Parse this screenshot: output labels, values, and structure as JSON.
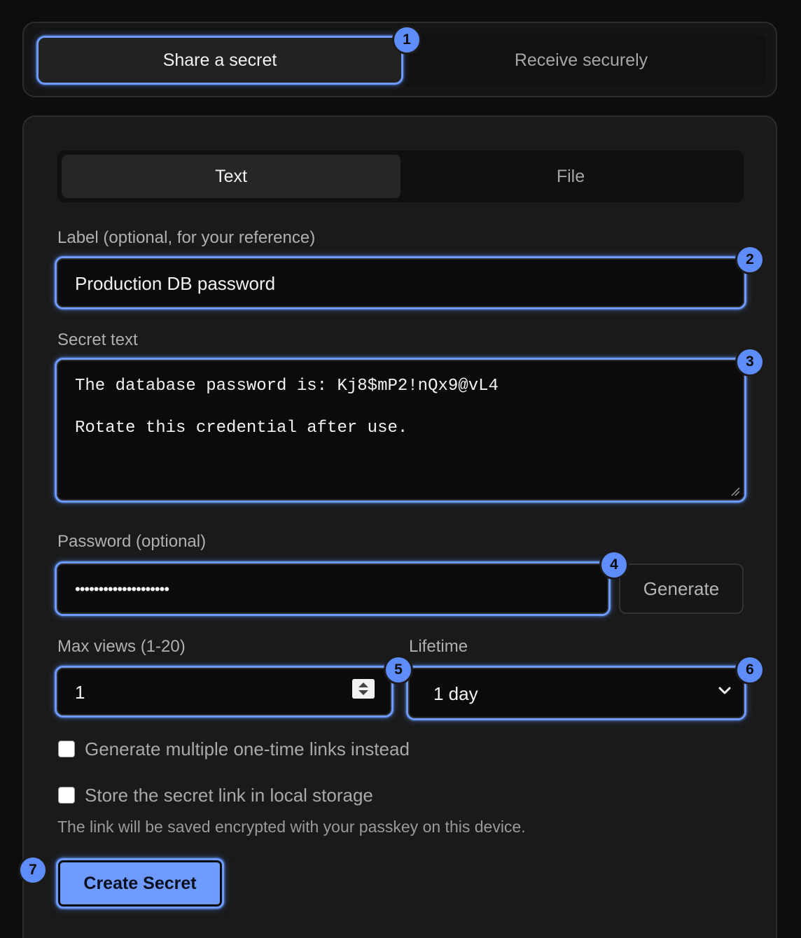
{
  "mode_tabs": {
    "share": "Share a secret",
    "receive": "Receive securely"
  },
  "content_tabs": {
    "text": "Text",
    "file": "File"
  },
  "label_field": {
    "label": "Label (optional, for your reference)",
    "value": "Production DB password"
  },
  "secret_field": {
    "label": "Secret text",
    "lines": [
      "The database password is: Kj8$mP2!nQx9@vL4",
      "",
      "Rotate this credential after use."
    ]
  },
  "password_field": {
    "label": "Password (optional)",
    "masked_value": "••••••••••••••••••••",
    "generate_label": "Generate"
  },
  "max_views": {
    "label": "Max views (1-20)",
    "value": "1"
  },
  "lifetime": {
    "label": "Lifetime",
    "selected": "1 day"
  },
  "options": {
    "multiple_links": "Generate multiple one-time links instead",
    "store_local": "Store the secret link in local storage",
    "store_hint": "The link will be saved encrypted with your passkey on this device."
  },
  "submit": {
    "label": "Create Secret"
  },
  "badges": [
    "1",
    "2",
    "3",
    "4",
    "5",
    "6",
    "7"
  ],
  "colors": {
    "accent": "#6f9bff",
    "background": "#0d0d0d",
    "card": "#1a1a1a"
  }
}
